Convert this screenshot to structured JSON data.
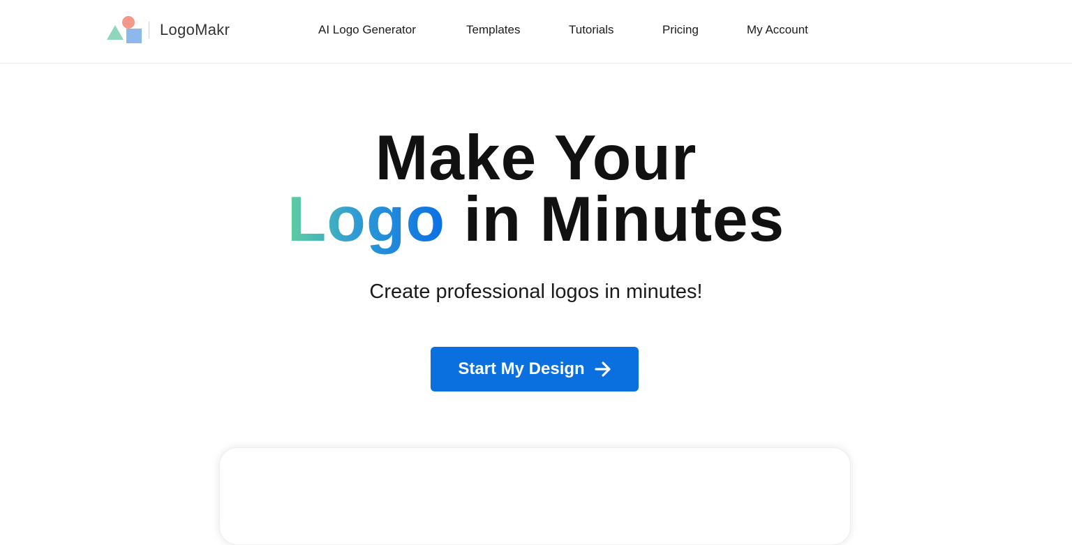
{
  "brand": {
    "name": "LogoMakr"
  },
  "nav": {
    "items": [
      {
        "label": "AI Logo Generator"
      },
      {
        "label": "Templates"
      },
      {
        "label": "Tutorials"
      },
      {
        "label": "Pricing"
      },
      {
        "label": "My Account"
      }
    ]
  },
  "hero": {
    "title_line1": "Make Your",
    "title_highlight": "Logo",
    "title_line2_rest": " in Minutes",
    "subtitle": "Create professional logos in minutes!",
    "cta_label": "Start My Design",
    "cta_icon": "arrow-right-icon"
  },
  "colors": {
    "accent": "#0a6fdf",
    "gradient_start": "#5fcf9f",
    "gradient_end": "#0b6fe3",
    "logo_triangle": "#8fd6bd",
    "logo_square": "#8db8ec",
    "logo_circle": "#f4998a"
  }
}
